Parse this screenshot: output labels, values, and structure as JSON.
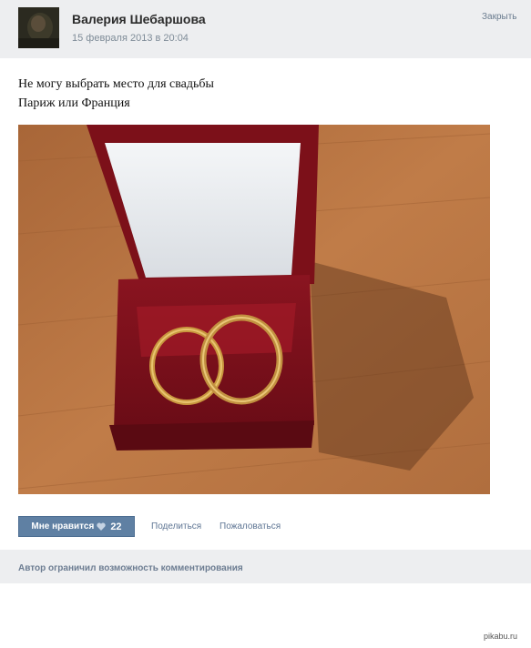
{
  "post": {
    "author": "Валерия Шебаршова",
    "date": "15 февраля 2013 в 20:04",
    "close_label": "Закрыть",
    "text_line1": "Не могу выбрать место для свадьбы",
    "text_line2": "Париж или Франция"
  },
  "actions": {
    "like_label": "Мне нравится",
    "like_count": "22",
    "share_label": "Поделиться",
    "report_label": "Пожаловаться"
  },
  "comments": {
    "notice": "Автор ограничил возможность комментирования"
  },
  "watermark": "pikabu.ru",
  "colors": {
    "header_bg": "#edeef0",
    "like_button": "#5f80a3",
    "link": "#5f7694"
  }
}
